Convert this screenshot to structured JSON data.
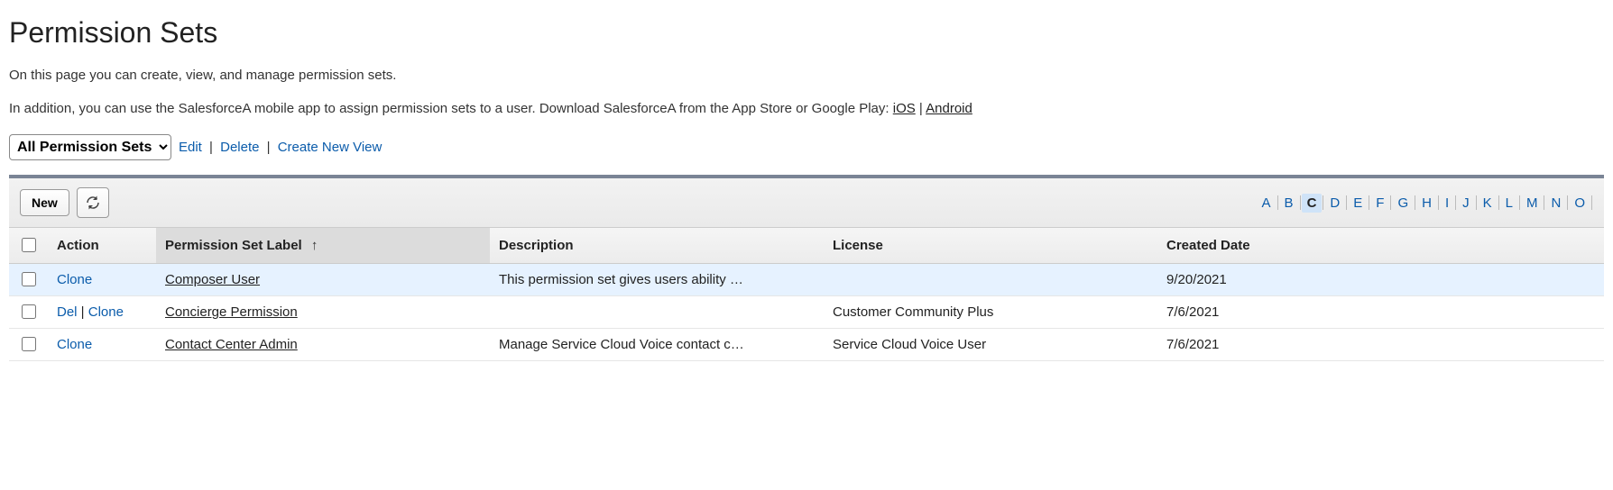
{
  "page": {
    "title": "Permission Sets",
    "intro1": "On this page you can create, view, and manage permission sets.",
    "intro2_pre": "In addition, you can use the SalesforceA mobile app to assign permission sets to a user. Download SalesforceA from the App Store or Google Play: ",
    "ios_link": "iOS",
    "sep": " | ",
    "android_link": "Android"
  },
  "view": {
    "selected": "All Permission Sets",
    "edit": "Edit",
    "delete": "Delete",
    "create": "Create New View"
  },
  "toolbar": {
    "new_button": "New"
  },
  "alpha": {
    "letters": [
      "A",
      "B",
      "C",
      "D",
      "E",
      "F",
      "G",
      "H",
      "I",
      "J",
      "K",
      "L",
      "M",
      "N",
      "O"
    ],
    "selected": "C"
  },
  "table": {
    "columns": {
      "action": "Action",
      "label": "Permission Set Label",
      "description": "Description",
      "license": "License",
      "created_date": "Created Date"
    },
    "sort_indicator": "↑",
    "action_labels": {
      "clone": "Clone",
      "del": "Del"
    },
    "rows": [
      {
        "highlight": true,
        "actions": [
          "clone"
        ],
        "label": "Composer User",
        "description": "This permission set gives users ability …",
        "license": "",
        "created_date": "9/20/2021"
      },
      {
        "highlight": false,
        "actions": [
          "del",
          "clone"
        ],
        "label": "Concierge Permission",
        "description": "",
        "license": "Customer Community Plus",
        "created_date": "7/6/2021"
      },
      {
        "highlight": false,
        "actions": [
          "clone"
        ],
        "label": "Contact Center Admin",
        "description": "Manage Service Cloud Voice contact c…",
        "license": "Service Cloud Voice User",
        "created_date": "7/6/2021"
      }
    ]
  }
}
